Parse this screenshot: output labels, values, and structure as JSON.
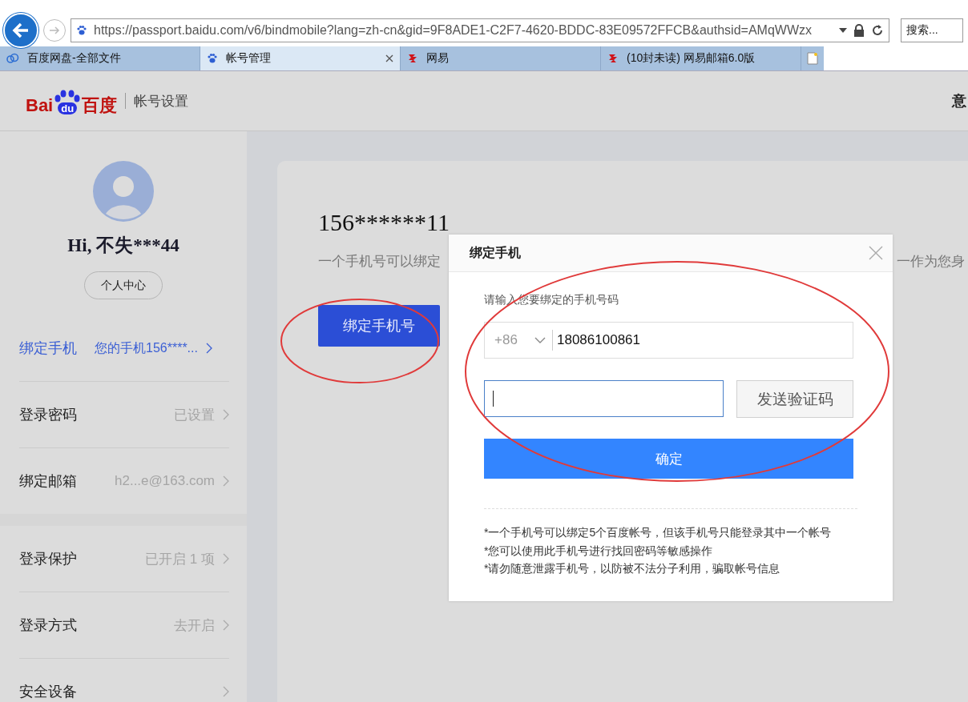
{
  "browser": {
    "url": "https://passport.baidu.com/v6/bindmobile?lang=zh-cn&gid=9F8ADE1-C2F7-4620-BDDC-83E09572FFCB&authsid=AMqWWzx",
    "search_placeholder": "搜索...",
    "forward_disabled": true,
    "tabs": [
      {
        "title": "百度网盘-全部文件",
        "kind": "cloud",
        "selected": false
      },
      {
        "title": "帐号管理",
        "kind": "paw",
        "selected": true
      },
      {
        "title": "网易",
        "kind": "netease",
        "selected": false
      },
      {
        "title": "(10封未读) 网易邮箱6.0版",
        "kind": "netease",
        "selected": false
      }
    ]
  },
  "header": {
    "logo": {
      "left": "Bai",
      "paw": "du",
      "right": "百度"
    },
    "section": "帐号设置",
    "right_text": "意"
  },
  "sidebar": {
    "greeting": "Hi, 不失***44",
    "profile_button": "个人中心",
    "groups": [
      {
        "items": [
          {
            "label": "绑定手机",
            "value": "您的手机156****...",
            "selected": true
          },
          {
            "label": "登录密码",
            "value": "已设置",
            "selected": false
          },
          {
            "label": "绑定邮箱",
            "value": "h2...e@163.com",
            "selected": false
          }
        ]
      },
      {
        "items": [
          {
            "label": "登录保护",
            "value": "已开启 1 项",
            "selected": false
          },
          {
            "label": "登录方式",
            "value": "去开启",
            "selected": false
          },
          {
            "label": "安全设备",
            "selected": false
          }
        ]
      }
    ]
  },
  "main": {
    "phone": "156******11",
    "description_left": "一个手机号可以绑定",
    "description_right": "一作为您身",
    "bind_button": "绑定手机号"
  },
  "dialog": {
    "title": "绑定手机",
    "hint": "请输入您要绑定的手机号码",
    "country_code": "+86",
    "phone_value": "18086100861",
    "send_code_button": "发送验证码",
    "confirm_button": "确定",
    "notes": [
      "*一个手机号可以绑定5个百度帐号，但该手机号只能登录其中一个帐号",
      "*您可以使用此手机号进行找回密码等敏感操作",
      "*请勿随意泄露手机号，以防被不法分子利用，骗取帐号信息"
    ]
  }
}
